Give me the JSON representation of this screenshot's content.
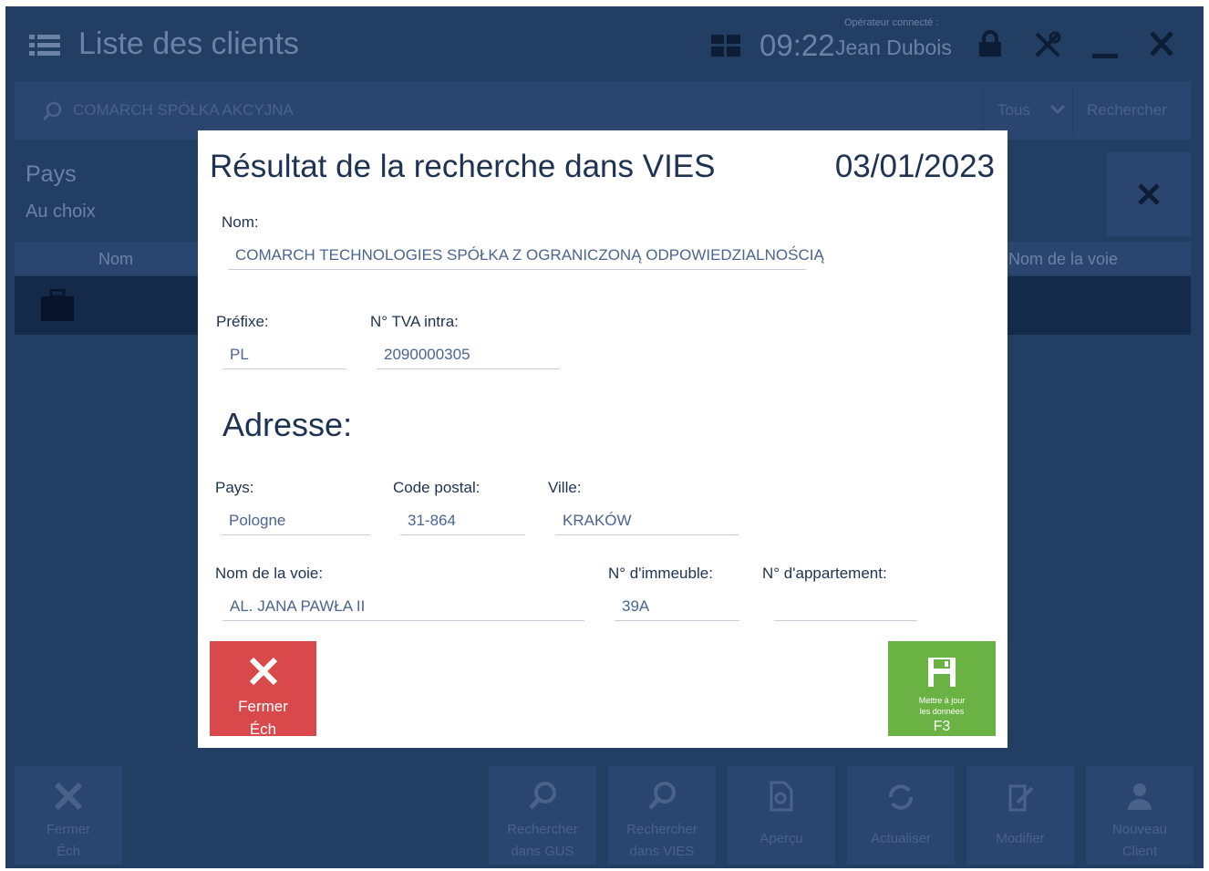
{
  "header": {
    "title": "Liste des clients",
    "time": "09:22",
    "operator_label": "Opérateur connecté :",
    "operator_name": "Jean Dubois"
  },
  "search": {
    "query": "COMARCH SPÓŁKA AKCYJNA",
    "scope": "Tous",
    "search_button": "Rechercher"
  },
  "filter": {
    "label": "Pays",
    "value": "Au choix"
  },
  "table": {
    "columns": [
      "Nom",
      "Nom de la voie"
    ]
  },
  "toolbar": {
    "close_label": "Fermer",
    "close_key": "Éch",
    "gus_line1": "Rechercher",
    "gus_line2": "dans GUS",
    "vies_line1": "Rechercher",
    "vies_line2": "dans VIES",
    "preview": "Aperçu",
    "refresh": "Actualiser",
    "edit": "Modifier",
    "new_line1": "Nouveau",
    "new_line2": "Client"
  },
  "dialog": {
    "title": "Résultat de la recherche dans VIES",
    "date": "03/01/2023",
    "name_label": "Nom:",
    "name_value": "COMARCH TECHNOLOGIES SPÓŁKA Z OGRANICZONĄ ODPOWIEDZIALNOŚCIĄ",
    "prefix_label": "Préfixe:",
    "prefix_value": "PL",
    "vat_label": "N° TVA intra:",
    "vat_value": "2090000305",
    "address_heading": "Adresse:",
    "country_label": "Pays:",
    "country_value": "Pologne",
    "postal_label": "Code postal:",
    "postal_value": "31-864",
    "city_label": "Ville:",
    "city_value": "KRAKÓW",
    "street_label": "Nom de la voie:",
    "street_value": "AL. JANA PAWŁA II",
    "building_label": "N° d'immeuble:",
    "building_value": "39A",
    "apartment_label": "N° d'appartement:",
    "apartment_value": "",
    "close_button": "Fermer",
    "close_key": "Éch",
    "update_line1": "Mettre à jour",
    "update_line2": "les données",
    "update_key": "F3"
  },
  "colors": {
    "background": "#233e63",
    "close_button": "#d9494b",
    "update_button": "#6bb244",
    "dialog_text": "#1e3252"
  }
}
